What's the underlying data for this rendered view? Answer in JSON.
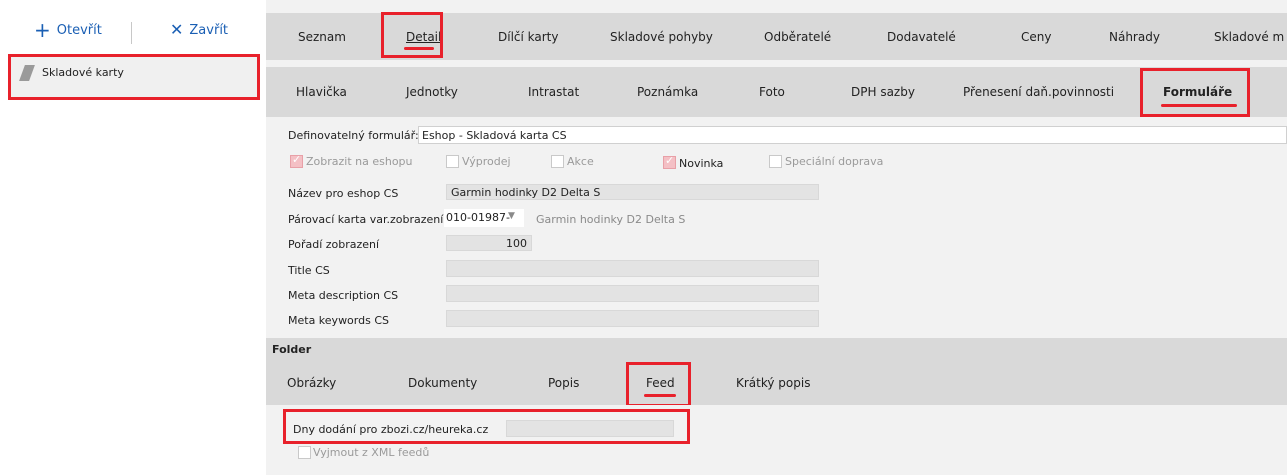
{
  "left": {
    "open_label": "Otevřít",
    "close_label": "Zavřít",
    "nav_item": "Skladové karty"
  },
  "main_tabs": [
    "Seznam",
    "Detail",
    "Dílčí karty",
    "Skladové pohyby",
    "Odběratelé",
    "Dodavatelé",
    "Ceny",
    "Náhrady",
    "Skladové m"
  ],
  "sub_tabs": [
    "Hlavička",
    "Jednotky",
    "Intrastat",
    "Poznámka",
    "Foto",
    "DPH sazby",
    "Přenesení daň.povinnosti",
    "Formuláře"
  ],
  "form": {
    "def_label": "Definovatelný formulář:",
    "def_value": "Eshop - Skladová karta CS",
    "checks": [
      {
        "label": "Zobrazit na eshopu",
        "checked": true
      },
      {
        "label": "Výprodej",
        "checked": false
      },
      {
        "label": "Akce",
        "checked": false
      },
      {
        "label": "Novinka",
        "checked": true
      },
      {
        "label": "Speciální doprava",
        "checked": false
      }
    ],
    "name_label": "Název pro eshop CS",
    "name_value": "Garmin hodinky D2 Delta S",
    "pair_label": "Párovací karta var.zobrazení",
    "pair_value": "010-01987-",
    "pair_desc": "Garmin hodinky D2 Delta S",
    "order_label": "Pořadí zobrazení",
    "order_value": "100",
    "title_label": "Title CS",
    "meta_desc_label": "Meta description CS",
    "meta_kw_label": "Meta keywords CS"
  },
  "folder": {
    "title": "Folder",
    "tabs": [
      "Obrázky",
      "Dokumenty",
      "Popis",
      "Feed",
      "Krátký popis"
    ]
  },
  "feed": {
    "days_label": "Dny dodání pro zbozi.cz/heureka.cz",
    "exclude_label": "Vyjmout z XML feedů"
  },
  "colors": {
    "highlight": "#e8212b",
    "accent": "#1a5fb4"
  }
}
